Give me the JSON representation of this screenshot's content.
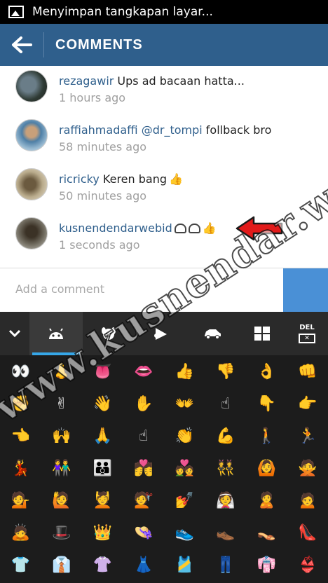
{
  "status_bar": {
    "notification": "Menyimpan tangkapan layar..."
  },
  "action_bar": {
    "title": "COMMENTS"
  },
  "comments": [
    {
      "user": "rezagawir",
      "mention": "",
      "text": " Ups ad bacaan hatta...",
      "time": "1 hours ago",
      "emoji": ""
    },
    {
      "user": "raffiahmadaffi",
      "mention": " @dr_tompi",
      "text": " follback bro",
      "time": "58 minutes ago",
      "emoji": ""
    },
    {
      "user": "ricricky",
      "mention": "",
      "text": " Keren bang",
      "time": "50 minutes ago",
      "emoji": "thumb"
    },
    {
      "user": "kusnendendarwebid",
      "mention": "",
      "text": "",
      "time": "1 seconds ago",
      "emoji": "android-android-thumb"
    }
  ],
  "composer": {
    "placeholder": "Add a comment"
  },
  "keyboard": {
    "delete_label": "DEL",
    "tabs": [
      "chevron-down-icon",
      "android-icon",
      "dog-icon",
      "bell-icon",
      "car-icon",
      "symbols-icon"
    ],
    "emoji_rows": [
      [
        "👀",
        "👃",
        "👅",
        "👄",
        "👍",
        "👎",
        "👌",
        "👊"
      ],
      [
        "✊",
        "✌",
        "👋",
        "✋",
        "👐",
        "☝",
        "👇",
        "👉"
      ],
      [
        "👈",
        "🙌",
        "🙏",
        "☝",
        "👏",
        "💪",
        "🚶",
        "🏃"
      ],
      [
        "💃",
        "👫",
        "👪",
        "💏",
        "💑",
        "👯",
        "🙆",
        "🙅"
      ],
      [
        "💁",
        "🙋",
        "💆",
        "💇",
        "💅",
        "👰",
        "🙎",
        "🙍"
      ],
      [
        "🙇",
        "🎩",
        "👑",
        "👒",
        "👟",
        "👞",
        "👡",
        "👠"
      ],
      [
        "👕",
        "👔",
        "👚",
        "👗",
        "🎽",
        "👖",
        "👘",
        "👙"
      ]
    ]
  },
  "watermark": "www.kusnendar.web.id"
}
